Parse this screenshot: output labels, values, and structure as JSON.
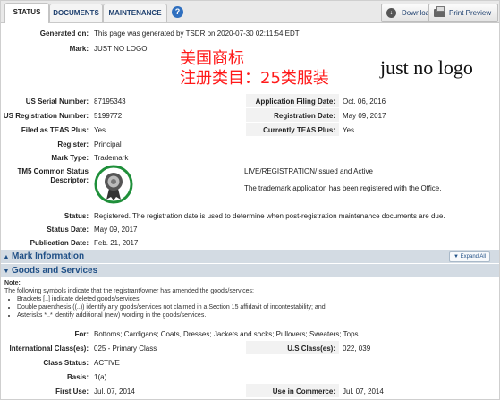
{
  "tabs": [
    "STATUS",
    "DOCUMENTS",
    "MAINTENANCE"
  ],
  "toolbar": {
    "download": "Download",
    "print": "Print Preview"
  },
  "generated": {
    "label": "Generated on:",
    "value": "This page was generated by TSDR on 2020-07-30 02:11:54 EDT"
  },
  "mark": {
    "label": "Mark:",
    "value": "JUST NO LOGO",
    "cn_line1": "美国商标",
    "cn_line2": "注册类目：25类服装",
    "literal": "just no logo"
  },
  "serial": {
    "label": "US Serial Number:",
    "value": "87195343"
  },
  "filing": {
    "label": "Application Filing Date:",
    "value": "Oct. 06, 2016"
  },
  "reg_no": {
    "label": "US Registration Number:",
    "value": "5199772"
  },
  "reg_date": {
    "label": "Registration Date:",
    "value": "May 09, 2017"
  },
  "teas_filed": {
    "label": "Filed as TEAS Plus:",
    "value": "Yes"
  },
  "teas_curr": {
    "label": "Currently TEAS Plus:",
    "value": "Yes"
  },
  "register": {
    "label": "Register:",
    "value": "Principal"
  },
  "mark_type": {
    "label": "Mark Type:",
    "value": "Trademark"
  },
  "tm5": {
    "label1": "TM5 Common Status",
    "label2": "Descriptor:",
    "line1": "LIVE/REGISTRATION/Issued and Active",
    "line2": "The trademark application has been registered with the Office."
  },
  "status": {
    "label": "Status:",
    "value": "Registered. The registration date is used to determine when post-registration maintenance documents are due."
  },
  "status_date": {
    "label": "Status Date:",
    "value": "May 09, 2017"
  },
  "pub_date": {
    "label": "Publication Date:",
    "value": "Feb. 21, 2017"
  },
  "sections": {
    "mark_info": "Mark Information",
    "expand_all": "Expand All",
    "goods": "Goods and Services"
  },
  "note": {
    "title": "Note:",
    "intro": "The following symbols indicate that the registrant/owner has amended the goods/services:",
    "items": [
      "Brackets [..] indicate deleted goods/services;",
      "Double parenthesis ((..)) identify any goods/services not claimed in a Section 15 affidavit of incontestability; and",
      "Asterisks *..* identify additional (new) wording in the goods/services."
    ]
  },
  "goods": {
    "for_label": "For:",
    "for_value": "Bottoms; Cardigans; Coats, Dresses; Jackets and socks; Pullovers; Sweaters; Tops",
    "intl_label": "International Class(es):",
    "intl_value": "025 - Primary Class",
    "us_label": "U.S Class(es):",
    "us_value": "022, 039",
    "class_status_label": "Class Status:",
    "class_status_value": "ACTIVE",
    "basis_label": "Basis:",
    "basis_value": "1(a)",
    "first_use_label": "First Use:",
    "first_use_value": "Jul. 07, 2014",
    "commerce_label": "Use in Commerce:",
    "commerce_value": "Jul. 07, 2014"
  },
  "colors": {
    "section_bg": "#d3dbe3",
    "section_text": "#1f4f86",
    "cn_red": "#ff1a1a",
    "badge_green": "#1f8f3a"
  }
}
